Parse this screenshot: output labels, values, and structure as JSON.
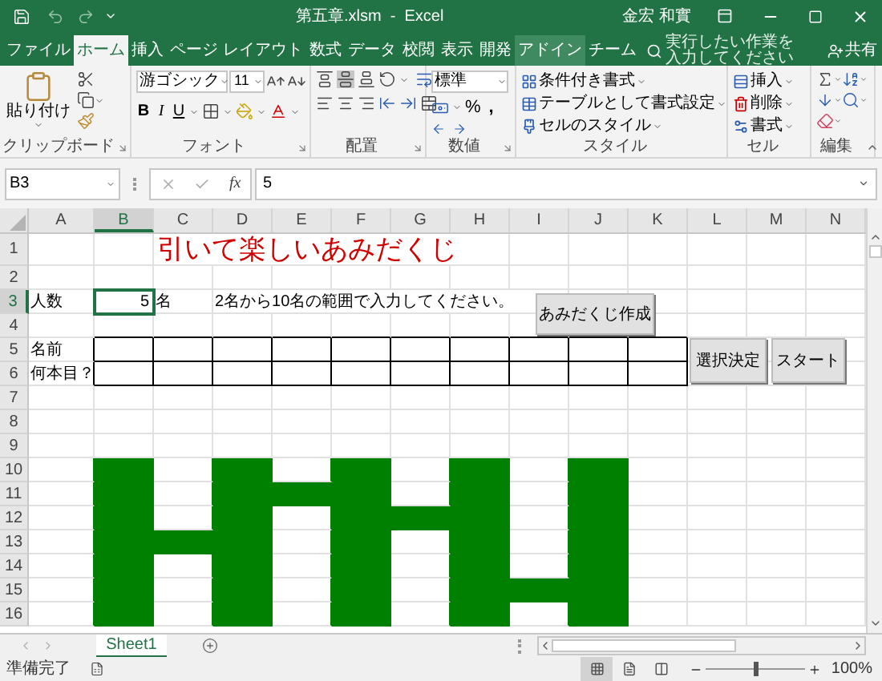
{
  "window": {
    "title": "第五章.xlsm  -  Excel",
    "user": "金宏 和實"
  },
  "tabs": [
    {
      "label": "ファイル",
      "selected": false,
      "highlighted": false
    },
    {
      "label": "ホーム",
      "selected": true,
      "highlighted": false
    },
    {
      "label": "挿入",
      "selected": false,
      "highlighted": false
    },
    {
      "label": "ページ レイアウト",
      "selected": false,
      "highlighted": false
    },
    {
      "label": "数式",
      "selected": false,
      "highlighted": false
    },
    {
      "label": "データ",
      "selected": false,
      "highlighted": false
    },
    {
      "label": "校閲",
      "selected": false,
      "highlighted": false
    },
    {
      "label": "表示",
      "selected": false,
      "highlighted": false
    },
    {
      "label": "開発",
      "selected": false,
      "highlighted": false
    },
    {
      "label": "アドイン",
      "selected": false,
      "highlighted": true
    },
    {
      "label": "チーム",
      "selected": false,
      "highlighted": false
    }
  ],
  "tell_me": {
    "placeholder": "実行したい作業を入力してください"
  },
  "share": "共有",
  "ribbon": {
    "clipboard": {
      "paste": "貼り付け",
      "label": "クリップボード"
    },
    "font": {
      "name": "游ゴシック",
      "size": "11",
      "bold": "B",
      "italic": "I",
      "underline": "U",
      "label": "フォント"
    },
    "alignment": {
      "label": "配置"
    },
    "number": {
      "format": "標準",
      "percent": "%",
      "comma": ",",
      "label": "数値"
    },
    "styles": {
      "items": [
        "条件付き書式",
        "テーブルとして書式設定",
        "セルのスタイル"
      ],
      "label": "スタイル"
    },
    "cells": {
      "items": [
        "挿入",
        "削除",
        "書式"
      ],
      "label": "セル"
    },
    "editing": {
      "label": "編集"
    }
  },
  "formula_bar": {
    "name_box": "B3",
    "function_label": "fx",
    "value": "5"
  },
  "sheet": {
    "columns": [
      {
        "label": "A",
        "selected": false
      },
      {
        "label": "B",
        "selected": true
      },
      {
        "label": "C",
        "selected": false
      },
      {
        "label": "D",
        "selected": false
      },
      {
        "label": "E",
        "selected": false
      },
      {
        "label": "F",
        "selected": false
      },
      {
        "label": "G",
        "selected": false
      },
      {
        "label": "H",
        "selected": false
      },
      {
        "label": "I",
        "selected": false
      },
      {
        "label": "J",
        "selected": false
      },
      {
        "label": "K",
        "selected": false
      },
      {
        "label": "L",
        "selected": false
      },
      {
        "label": "M",
        "selected": false
      },
      {
        "label": "N",
        "selected": false
      }
    ],
    "rows": [
      {
        "label": "1",
        "selected": false,
        "boxed": false,
        "cells": [
          "",
          "",
          {
            "text": "引いて楽しいあみだくじ",
            "kind": "title"
          }
        ]
      },
      {
        "label": "2",
        "selected": false,
        "boxed": false,
        "cells": []
      },
      {
        "label": "3",
        "selected": true,
        "boxed": false,
        "cells": [
          "人数",
          {
            "text": "5",
            "kind": "number"
          },
          "名",
          "2名から10名の範囲で入力してください。"
        ]
      },
      {
        "label": "4",
        "selected": false,
        "boxed": false,
        "cells": []
      },
      {
        "label": "5",
        "selected": false,
        "boxed": true,
        "cells": [
          "名前"
        ]
      },
      {
        "label": "6",
        "selected": false,
        "boxed": true,
        "cells": [
          "何本目？"
        ]
      },
      {
        "label": "7",
        "selected": false,
        "boxed": false,
        "cells": []
      },
      {
        "label": "8",
        "selected": false,
        "boxed": false,
        "cells": []
      },
      {
        "label": "9",
        "selected": false,
        "boxed": false,
        "cells": []
      },
      {
        "label": "10",
        "selected": false,
        "boxed": false,
        "cells": [],
        "shaded": [
          false,
          true,
          false,
          true,
          false,
          true,
          false,
          true,
          false,
          true
        ]
      },
      {
        "label": "11",
        "selected": false,
        "boxed": false,
        "cells": [],
        "shaded": [
          false,
          true,
          false,
          true,
          true,
          true,
          false,
          true,
          false,
          true
        ]
      },
      {
        "label": "12",
        "selected": false,
        "boxed": false,
        "cells": [],
        "shaded": [
          false,
          true,
          false,
          true,
          false,
          true,
          true,
          true,
          false,
          true
        ]
      },
      {
        "label": "13",
        "selected": false,
        "boxed": false,
        "cells": [],
        "shaded": [
          false,
          true,
          true,
          true,
          false,
          true,
          false,
          true,
          false,
          true
        ]
      },
      {
        "label": "14",
        "selected": false,
        "boxed": false,
        "cells": [],
        "shaded": [
          false,
          true,
          false,
          true,
          false,
          true,
          false,
          true,
          false,
          true
        ]
      },
      {
        "label": "15",
        "selected": false,
        "boxed": false,
        "cells": [],
        "shaded": [
          false,
          true,
          false,
          true,
          false,
          true,
          false,
          true,
          true,
          true
        ]
      },
      {
        "label": "16",
        "selected": false,
        "boxed": false,
        "cells": [],
        "shaded": [
          false,
          true,
          false,
          true,
          false,
          true,
          false,
          true,
          false,
          true
        ]
      }
    ],
    "buttons": [
      "あみだくじ作成",
      "選択決定",
      "スタート"
    ]
  },
  "sheet_tabs": [
    {
      "label": "Sheet1",
      "selected": true
    }
  ],
  "status_bar": {
    "text": "準備完了",
    "views": [
      {
        "kind": "normal",
        "selected": true
      },
      {
        "kind": "page_layout",
        "selected": false
      },
      {
        "kind": "page_break",
        "selected": false
      }
    ],
    "zoom": {
      "level": 0.5,
      "reading": "100%"
    }
  }
}
